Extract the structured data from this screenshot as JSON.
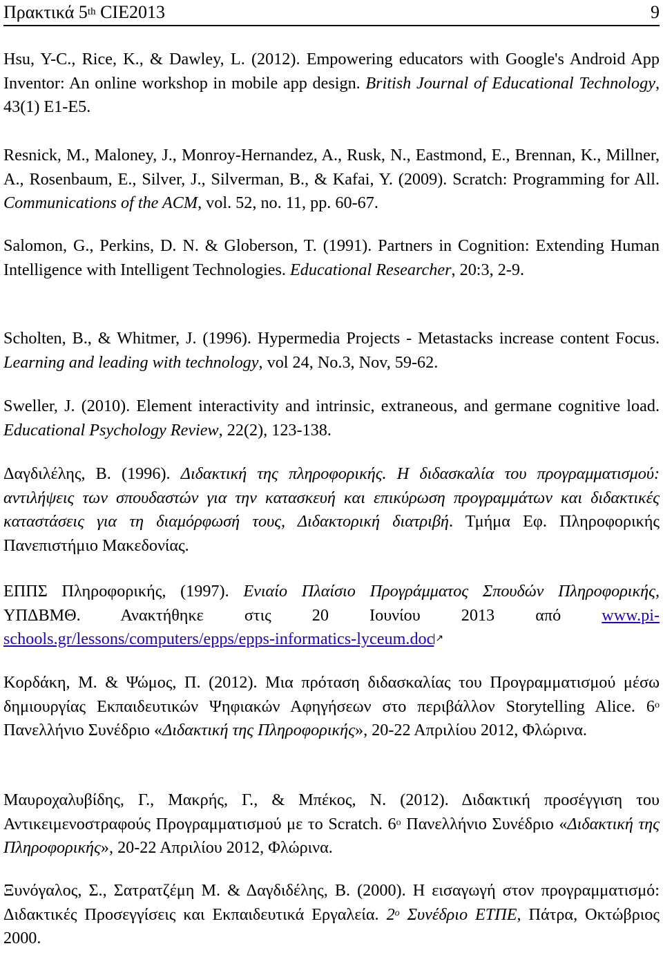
{
  "header": {
    "title_prefix": "Πρακτικά 5",
    "title_sup": "th",
    "title_suffix": " CIE2013",
    "page_number": "9"
  },
  "references": [
    {
      "parts": [
        {
          "t": "Hsu, Y-C., Rice, K., & Dawley, L. (2012). Empowering educators with Google's Android App Inventor: An online workshop in mobile app design. "
        },
        {
          "t": "British Journal of Educational Technology",
          "i": true
        },
        {
          "t": ", 43(1) E1-E5."
        }
      ]
    },
    {
      "parts": [
        {
          "t": "Resnick, M., Maloney, J., Monroy-Hernandez, A., Rusk, N., Eastmond, E., Brennan, K., Millner, A., Rosenbaum, E., Silver, J., Silverman, B., & Kafai, Y. (2009). Scratch: Programming for All. "
        },
        {
          "t": "Communications of the ACM",
          "i": true
        },
        {
          "t": ", vol. 52, no. 11, pp. 60-67."
        }
      ]
    },
    {
      "parts": [
        {
          "t": "Salomon, G., Perkins, D. N. & Globerson, T. (1991). Partners in Cognition: Extending Human Intelligence with Intelligent Technologies. "
        },
        {
          "t": "Educational Researcher",
          "i": true
        },
        {
          "t": ", 20:3, 2-9."
        }
      ]
    },
    {
      "parts": [
        {
          "t": "Scholten, B., & Whitmer, J. (1996). Hypermedia Projects - Metastacks increase content Focus. "
        },
        {
          "t": "Learning and leading with technology",
          "i": true
        },
        {
          "t": ", vol 24, No.3, Nov, 59-62."
        }
      ]
    },
    {
      "parts": [
        {
          "t": "Sweller, J. (2010). Element interactivity and intrinsic, extraneous, and germane cognitive load. "
        },
        {
          "t": "Educational Psychology Review",
          "i": true
        },
        {
          "t": ", 22(2), 123-138."
        }
      ]
    },
    {
      "parts": [
        {
          "t": "Δαγδιλέλης, Β. (1996). "
        },
        {
          "t": "Διδακτική της πληροφορικής. Η διδασκαλία του προγραμματισμού: αντιλήψεις των σπουδαστών για την κατασκευή και επικύρωση προγραμμάτων και διδακτικές καταστάσεις για τη διαμόρφωσή τους, Διδακτορική διατριβή",
          "i": true
        },
        {
          "t": ". Τμήμα Εφ. Πληροφορικής Πανεπιστήμιο Μακεδονίας."
        }
      ]
    },
    {
      "parts": [
        {
          "t": "ΕΠΠΣ Πληροφορικής, (1997). "
        },
        {
          "t": "Ενιαίο Πλαίσιο Προγράμματος Σπουδών Πληροφορικής",
          "i": true
        },
        {
          "t": ", ΥΠΔΒΜΘ. Ανακτήθηκε στις 20 Ιουνίου 2013 από "
        },
        {
          "t": "www.pi-schools.gr/lessons/computers/epps/epps-informatics-lyceum.doc",
          "link": true
        }
      ]
    },
    {
      "parts": [
        {
          "t": "Κορδάκη, Μ. & Ψώμος, Π. (2012). Μια πρόταση διδασκαλίας του Προγραμματισμού μέσω δημιουργίας Εκπαιδευτικών Ψηφιακών Αφηγήσεων στο περιβάλλον Storytelling Alice. 6"
        },
        {
          "t": "ο",
          "sup": true
        },
        {
          "t": " Πανελλήνιο Συνέδριο «"
        },
        {
          "t": "Διδακτική της Πληροφορικής",
          "i": true
        },
        {
          "t": "», 20-22 Απριλίου 2012, Φλώρινα."
        }
      ]
    },
    {
      "parts": [
        {
          "t": "Μαυροχαλυβίδης, Γ., Μακρής, Γ., & Μπέκος, Ν. (2012). Διδακτική προσέγγιση του Αντικειμενοστραφούς Προγραμματισμού με το Scratch. 6"
        },
        {
          "t": "ο",
          "sup": true
        },
        {
          "t": " Πανελλήνιο Συνέδριο «"
        },
        {
          "t": "Διδακτική της Πληροφορικής",
          "i": true
        },
        {
          "t": "», 20-22 Απριλίου 2012, Φλώρινα."
        }
      ]
    },
    {
      "parts": [
        {
          "t": "Ξυνόγαλος, Σ., Σατρατζέμη Μ. & Δαγδιδέλης, Β. (2000). Η εισαγωγή στον προγραμματισμό: Διδακτικές Προσεγγίσεις και Εκπαιδευτικά Εργαλεία. "
        },
        {
          "t": "2",
          "i": true
        },
        {
          "t": "ο",
          "sup": true,
          "i": true
        },
        {
          "t": " Συνέδριο ΕΤΠΕ",
          "i": true
        },
        {
          "t": ", Πάτρα, Οκτώβριος 2000."
        }
      ]
    }
  ]
}
